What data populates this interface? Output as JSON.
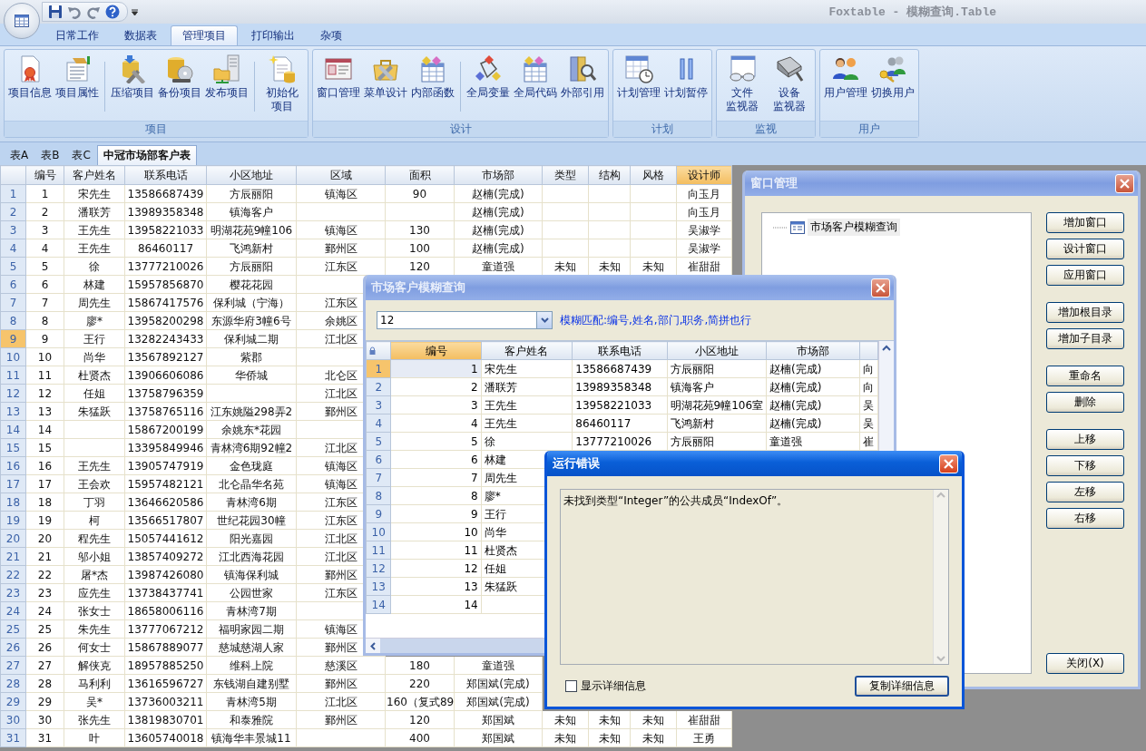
{
  "window": {
    "title": "Foxtable - 模糊查询.Table"
  },
  "ribbon": {
    "tabs": [
      {
        "label": "日常工作",
        "selected": false
      },
      {
        "label": "数据表",
        "selected": false
      },
      {
        "label": "管理项目",
        "selected": true
      },
      {
        "label": "打印输出",
        "selected": false
      },
      {
        "label": "杂项",
        "selected": false
      }
    ],
    "groups": [
      {
        "label": "项目",
        "sections": [
          [
            {
              "lines": [
                "项目信息"
              ]
            },
            {
              "lines": [
                "项目属性"
              ]
            }
          ],
          [
            {
              "lines": [
                "压缩项目"
              ]
            },
            {
              "lines": [
                "备份项目"
              ]
            },
            {
              "lines": [
                "发布项目"
              ]
            }
          ],
          [
            {
              "lines": [
                "初始化",
                "项目"
              ]
            }
          ]
        ]
      },
      {
        "label": "设计",
        "sections": [
          [
            {
              "lines": [
                "窗口管理"
              ]
            },
            {
              "lines": [
                "菜单设计"
              ]
            },
            {
              "lines": [
                "内部函数"
              ]
            }
          ],
          [
            {
              "lines": [
                "全局变量"
              ]
            },
            {
              "lines": [
                "全局代码"
              ]
            },
            {
              "lines": [
                "外部引用"
              ]
            }
          ]
        ]
      },
      {
        "label": "计划",
        "sections": [
          [
            {
              "lines": [
                "计划管理"
              ]
            },
            {
              "lines": [
                "计划暂停"
              ]
            }
          ]
        ]
      },
      {
        "label": "监视",
        "sections": [
          [
            {
              "lines": [
                "文件",
                "监视器"
              ]
            },
            {
              "lines": [
                "设备",
                "监视器"
              ]
            }
          ]
        ]
      },
      {
        "label": "用户",
        "sections": [
          [
            {
              "lines": [
                "用户管理"
              ]
            },
            {
              "lines": [
                "切换用户"
              ]
            }
          ]
        ]
      }
    ]
  },
  "sheet": {
    "tabs": [
      {
        "label": "表A",
        "selected": false
      },
      {
        "label": "表B",
        "selected": false
      },
      {
        "label": "表C",
        "selected": false
      },
      {
        "label": "中冠市场部客户表",
        "selected": true
      }
    ],
    "columns": [
      {
        "label": "编号",
        "selected": false
      },
      {
        "label": "客户姓名",
        "selected": false
      },
      {
        "label": "联系电话",
        "selected": false
      },
      {
        "label": "小区地址",
        "selected": false
      },
      {
        "label": "区域",
        "selected": false
      },
      {
        "label": "面积",
        "selected": false
      },
      {
        "label": "市场部",
        "selected": false
      },
      {
        "label": "类型",
        "selected": false
      },
      {
        "label": "结构",
        "selected": false
      },
      {
        "label": "风格",
        "selected": false
      },
      {
        "label": "设计师",
        "selected": true
      }
    ],
    "rows": [
      {
        "number": "1",
        "selected": false,
        "cells": [
          "1",
          "宋先生",
          "13586687439",
          "方辰丽阳",
          "镇海区",
          "90",
          "赵楠(完成)",
          null,
          null,
          null,
          "向玉月"
        ]
      },
      {
        "number": "2",
        "selected": false,
        "cells": [
          "2",
          "潘联芳",
          "13989358348",
          "镇海客户",
          null,
          null,
          "赵楠(完成)",
          null,
          null,
          null,
          "向玉月"
        ]
      },
      {
        "number": "3",
        "selected": false,
        "cells": [
          "3",
          "王先生",
          "13958221033",
          "明湖花苑9幢106",
          "镇海区",
          "130",
          "赵楠(完成)",
          null,
          null,
          null,
          "吴淑学"
        ]
      },
      {
        "number": "4",
        "selected": false,
        "cells": [
          "4",
          "王先生",
          "86460117",
          "飞鸿新村",
          "鄞州区",
          "100",
          "赵楠(完成)",
          null,
          null,
          null,
          "吴淑学"
        ]
      },
      {
        "number": "5",
        "selected": false,
        "cells": [
          "5",
          "徐",
          "13777210026",
          "方辰丽阳",
          "江东区",
          "120",
          "童道强",
          "未知",
          "未知",
          "未知",
          "崔甜甜"
        ]
      },
      {
        "number": "6",
        "selected": false,
        "cells": [
          "6",
          "林建",
          "15957856870",
          "樱花花园",
          null
        ]
      },
      {
        "number": "7",
        "selected": false,
        "cells": [
          "7",
          "周先生",
          "15867417576",
          "保利城（宁海）",
          "江东区"
        ]
      },
      {
        "number": "8",
        "selected": false,
        "cells": [
          "8",
          "廖*",
          "13958200298",
          "东源华府3幢6号",
          "余姚区"
        ]
      },
      {
        "number": "9",
        "selected": true,
        "cells": [
          "9",
          "王行",
          "13282243433",
          "保利城二期",
          "江北区"
        ]
      },
      {
        "number": "10",
        "selected": false,
        "cells": [
          "10",
          "尚华",
          "13567892127",
          "紫郡",
          null
        ]
      },
      {
        "number": "11",
        "selected": false,
        "cells": [
          "11",
          "杜贤杰",
          "13906606086",
          "华侨城",
          "北仑区"
        ]
      },
      {
        "number": "12",
        "selected": false,
        "cells": [
          "12",
          "任姐",
          "13758796359",
          null,
          "江北区"
        ]
      },
      {
        "number": "13",
        "selected": false,
        "cells": [
          "13",
          "朱猛跃",
          "13758765116",
          "江东姚隘298弄2",
          "鄞州区"
        ]
      },
      {
        "number": "14",
        "selected": false,
        "cells": [
          "14",
          null,
          "15867200199",
          "余姚东*花园",
          null
        ]
      },
      {
        "number": "15",
        "selected": false,
        "cells": [
          "15",
          null,
          "13395849946",
          "青林湾6期92幢2",
          "江北区"
        ]
      },
      {
        "number": "16",
        "selected": false,
        "cells": [
          "16",
          "王先生",
          "13905747919",
          "金色珑庭",
          "镇海区"
        ]
      },
      {
        "number": "17",
        "selected": false,
        "cells": [
          "17",
          "王会欢",
          "15957482121",
          "北仑晶华名苑",
          "镇海区"
        ]
      },
      {
        "number": "18",
        "selected": false,
        "cells": [
          "18",
          "丁羽",
          "13646620586",
          "青林湾6期",
          "江东区"
        ]
      },
      {
        "number": "19",
        "selected": false,
        "cells": [
          "19",
          "柯",
          "13566517807",
          "世纪花园30幢",
          "江东区"
        ]
      },
      {
        "number": "20",
        "selected": false,
        "cells": [
          "20",
          "程先生",
          "15057441612",
          "阳光嘉园",
          "江北区"
        ]
      },
      {
        "number": "21",
        "selected": false,
        "cells": [
          "21",
          "邬小姐",
          "13857409272",
          "江北西海花园",
          "江北区"
        ]
      },
      {
        "number": "22",
        "selected": false,
        "cells": [
          "22",
          "屠*杰",
          "13987426080",
          "镇海保利城",
          "鄞州区"
        ]
      },
      {
        "number": "23",
        "selected": false,
        "cells": [
          "23",
          "应先生",
          "13738437741",
          "公园世家",
          "江东区"
        ]
      },
      {
        "number": "24",
        "selected": false,
        "cells": [
          "24",
          "张女士",
          "18658006116",
          "青林湾7期",
          null
        ]
      },
      {
        "number": "25",
        "selected": false,
        "cells": [
          "25",
          "朱先生",
          "13777067212",
          "福明家园二期",
          "镇海区"
        ]
      },
      {
        "number": "26",
        "selected": false,
        "cells": [
          "26",
          "何女士",
          "15867889077",
          "慈城慈湖人家",
          "鄞州区"
        ]
      },
      {
        "number": "27",
        "selected": false,
        "cells": [
          "27",
          "解侠克",
          "18957885250",
          "维科上院",
          "慈溪区",
          "180",
          "童道强"
        ]
      },
      {
        "number": "28",
        "selected": false,
        "cells": [
          "28",
          "马利利",
          "13616596727",
          "东钱湖自建别墅",
          "鄞州区",
          "220",
          "郑国斌(完成)"
        ]
      },
      {
        "number": "29",
        "selected": false,
        "cells": [
          "29",
          "吴*",
          "13736003211",
          "青林湾5期",
          "江北区",
          "160（复式89",
          "郑国斌(完成)"
        ]
      },
      {
        "number": "30",
        "selected": false,
        "cells": [
          "30",
          "张先生",
          "13819830701",
          "和泰雅院",
          "鄞州区",
          "120",
          "郑国斌",
          "未知",
          "未知",
          "未知",
          "崔甜甜"
        ]
      },
      {
        "number": "31",
        "selected": false,
        "cells": [
          "31",
          "叶",
          "13605740018",
          "镇海华丰景城11",
          null,
          "400",
          "郑国斌",
          "未知",
          "未知",
          "未知",
          "王勇"
        ]
      }
    ]
  },
  "window_manager": {
    "title": "窗口管理",
    "tree": [
      {
        "label": "市场客户模糊查询"
      }
    ],
    "button_groups": [
      [
        "增加窗口",
        "设计窗口",
        "应用窗口"
      ],
      [
        "增加根目录",
        "增加子目录"
      ],
      [
        "重命名",
        "删除"
      ],
      [
        "上移",
        "下移",
        "左移",
        "右移"
      ]
    ],
    "close_button": "关闭(X)"
  },
  "query_window": {
    "title": "市场客户模糊查询",
    "search": {
      "value": "12"
    },
    "hint": "模糊匹配:编号,姓名,部门,职务,简拼也行",
    "columns": [
      {
        "label": "编号",
        "selected": true
      },
      {
        "label": "客户姓名",
        "selected": false
      },
      {
        "label": "联系电话",
        "selected": false
      },
      {
        "label": "小区地址",
        "selected": false
      },
      {
        "label": "市场部",
        "selected": false
      }
    ],
    "rows": [
      {
        "number": "1",
        "selected": true,
        "cells": [
          "1",
          "宋先生",
          "13586687439",
          "方辰丽阳",
          "赵楠(完成)",
          "向"
        ]
      },
      {
        "number": "2",
        "selected": false,
        "cells": [
          "2",
          "潘联芳",
          "13989358348",
          "镇海客户",
          "赵楠(完成)",
          "向"
        ]
      },
      {
        "number": "3",
        "selected": false,
        "cells": [
          "3",
          "王先生",
          "13958221033",
          "明湖花苑9幢106室",
          "赵楠(完成)",
          "吴"
        ]
      },
      {
        "number": "4",
        "selected": false,
        "cells": [
          "4",
          "王先生",
          "86460117",
          "飞鸿新村",
          "赵楠(完成)",
          "吴"
        ]
      },
      {
        "number": "5",
        "selected": false,
        "cells": [
          "5",
          "徐",
          "13777210026",
          "方辰丽阳",
          "童道强",
          "崔"
        ]
      },
      {
        "number": "6",
        "selected": false,
        "cells": [
          "6",
          "林建"
        ]
      },
      {
        "number": "7",
        "selected": false,
        "cells": [
          "7",
          "周先生"
        ]
      },
      {
        "number": "8",
        "selected": false,
        "cells": [
          "8",
          "廖*"
        ]
      },
      {
        "number": "9",
        "selected": false,
        "cells": [
          "9",
          "王行"
        ]
      },
      {
        "number": "10",
        "selected": false,
        "cells": [
          "10",
          "尚华"
        ]
      },
      {
        "number": "11",
        "selected": false,
        "cells": [
          "11",
          "杜贤杰"
        ]
      },
      {
        "number": "12",
        "selected": false,
        "cells": [
          "12",
          "任姐"
        ]
      },
      {
        "number": "13",
        "selected": false,
        "cells": [
          "13",
          "朱猛跃"
        ]
      },
      {
        "number": "14",
        "selected": false,
        "cells": [
          "14"
        ]
      }
    ]
  },
  "error_dialog": {
    "title": "运行错误",
    "message": "未找到类型“Integer”的公共成员“IndexOf”。",
    "details_checkbox": {
      "label": "显示详细信息",
      "checked": false
    },
    "copy_button": "复制详细信息"
  }
}
